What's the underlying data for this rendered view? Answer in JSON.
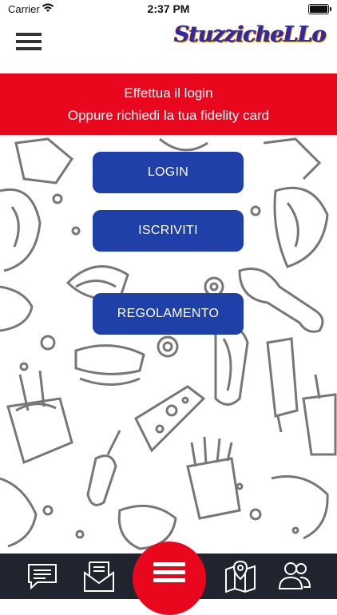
{
  "status_bar": {
    "carrier": "Carrier",
    "time": "2:37 PM"
  },
  "header": {
    "logo_text": "StuzzicheLLo"
  },
  "banner": {
    "line1": "Effettua il login",
    "line2": "Oppure richiedi la tua fidelity card"
  },
  "buttons": {
    "login": "LOGIN",
    "iscriviti": "ISCRIVITI",
    "regolamento": "REGOLAMENTO"
  },
  "colors": {
    "brand_red": "#e8071c",
    "button_blue": "#1f3fa9",
    "tabbar_bg": "#20242e"
  },
  "tabbar": {
    "items": [
      {
        "icon": "chat-icon"
      },
      {
        "icon": "envelope-icon"
      },
      {
        "icon": "menu-icon"
      },
      {
        "icon": "map-icon"
      },
      {
        "icon": "users-icon"
      }
    ]
  }
}
